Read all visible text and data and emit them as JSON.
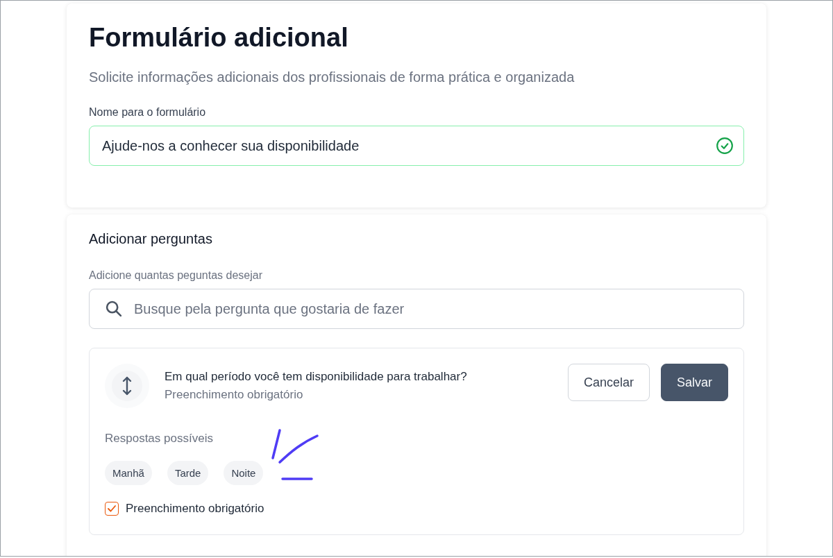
{
  "header": {
    "title": "Formulário adicional",
    "subtitle": "Solicite informações adicionais dos profissionais de forma prática e organizada"
  },
  "name_field": {
    "label": "Nome para o formulário",
    "value": "Ajude-nos a conhecer sua disponibilidade",
    "valid": true
  },
  "questions": {
    "title": "Adicionar perguntas",
    "hint": "Adicione quantas peguntas desejar",
    "search": {
      "placeholder": "Busque pela pergunta que gostaria de fazer"
    },
    "question": {
      "text": "Em qual período você tem disponibilidade para trabalhar?",
      "subtitle": "Preenchimento obrigatório",
      "buttons": [
        {
          "label": "Cancelar",
          "kind": "secondary"
        },
        {
          "label": "Salvar",
          "kind": "primary"
        }
      ],
      "answers_label": "Respostas possíveis",
      "answers": [
        "Manhã",
        "Tarde",
        "Noite"
      ],
      "required": {
        "label": "Preenchimento obrigatório",
        "checked": true
      }
    }
  }
}
